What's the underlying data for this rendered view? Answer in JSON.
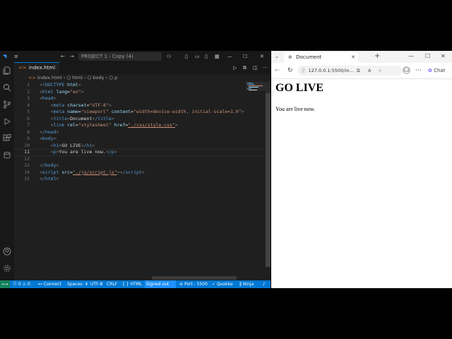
{
  "vscode": {
    "window_title": "PROJECT 1 - Copy (4)",
    "tab": {
      "label": "index.html",
      "icon": "<>"
    },
    "breadcrumb": [
      "index.html",
      "html",
      "body",
      "p"
    ],
    "code_lines": [
      {
        "n": "1"
      },
      {
        "n": "2"
      },
      {
        "n": "3"
      },
      {
        "n": "4"
      },
      {
        "n": "5"
      },
      {
        "n": "6"
      },
      {
        "n": "7"
      },
      {
        "n": "8"
      },
      {
        "n": "9"
      },
      {
        "n": "10"
      },
      {
        "n": "11"
      },
      {
        "n": "12"
      },
      {
        "n": "13"
      },
      {
        "n": "14"
      },
      {
        "n": "15"
      }
    ],
    "code": {
      "l1_kw": "!DOCTYPE",
      "l1_attr": "html",
      "l2_tag": "html",
      "l2_attr": "lang",
      "l2_val": "\"en\"",
      "l3_tag": "head",
      "l4_tag": "meta",
      "l4_attr": "charset",
      "l4_val": "\"UTF-8\"",
      "l5_tag": "meta",
      "l5_attr1": "name",
      "l5_val1": "\"viewport\"",
      "l5_attr2": "content",
      "l5_val2": "\"width=device-width, initial-scale=1.0\"",
      "l6_tag": "title",
      "l6_text": "Document",
      "l6_close": "/title",
      "l7_tag": "link",
      "l7_attr1": "rel",
      "l7_val1": "\"stylesheet\"",
      "l7_attr2": "href",
      "l7_val2": "\"./css/style.css\"",
      "l8_tag": "/head",
      "l9_tag": "body",
      "l10_tag": "h1",
      "l10_text": "GO LIVE",
      "l10_close": "/h1",
      "l11_tag": "p",
      "l11_text": "You are live now.",
      "l11_close": "/p",
      "l13_tag": "/body",
      "l14_tag": "script",
      "l14_attr": "src",
      "l14_val": "\"./js/script.js\"",
      "l14_close": "/script",
      "l15_tag": "/html"
    },
    "status": {
      "errors": "0",
      "warnings": "0",
      "connect": "Connect",
      "spaces": "Spaces: 4",
      "encoding": "UTF-8",
      "eol": "CRLF",
      "language": "HTML",
      "signed_out": "Signed out",
      "port": "Port : 5500",
      "quokka": "Quokka",
      "ninja": "Ninja",
      "language_braces": "{ }"
    }
  },
  "browser": {
    "tab_title": "Document",
    "url": "127.0.0.1:5500/in...",
    "chat_label": "Chat",
    "page": {
      "heading": "GO LIVE",
      "paragraph": "You are live now."
    }
  },
  "colors": {
    "accent": "#0078d4",
    "remote": "#16825d"
  }
}
